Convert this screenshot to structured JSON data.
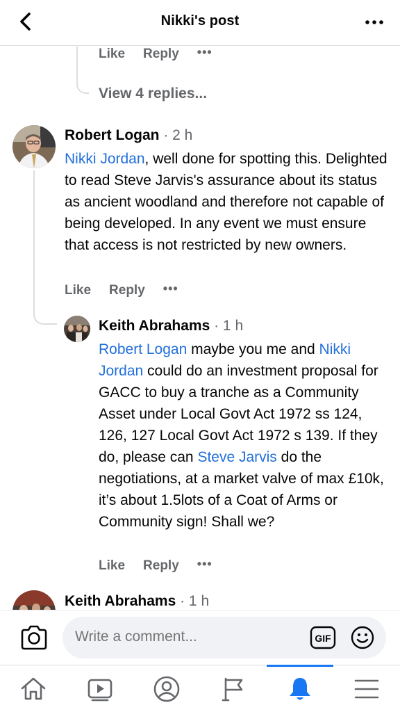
{
  "header": {
    "title": "Nikki's post"
  },
  "thread": {
    "prev_actions": {
      "like": "Like",
      "reply": "Reply",
      "more": "•••"
    },
    "view_replies": "View 4 replies..."
  },
  "comment1": {
    "author": "Robert Logan",
    "time": " · 2 h",
    "tag": "Nikki Jordan",
    "text": ", well done for spotting this. Delighted to read Steve Jarvis's assurance about its status as ancient woodland and therefore not capable of being developed. In any event we must ensure that access is not restricted by new owners.",
    "like": "Like",
    "reply": "Reply",
    "more": "•••"
  },
  "reply1": {
    "author": "Keith Abrahams",
    "time": " · 1 h",
    "tag1": "Robert Logan",
    "text1": " maybe you me and ",
    "tag2": "Nikki Jordan",
    "text2": " could do an investment proposal for GACC to buy a tranche as a Community Asset under   Local Govt Act 1972 ss 124, 126, 127 Local Govt Act 1972 s 139. If they do, please can ",
    "tag3": "Steve Jarvis",
    "text3": " do the negotiations, at a market valve of max £10k, it’s about 1.5lots of a Coat of Arms or Community sign! Shall we?",
    "like": "Like",
    "reply": "Reply",
    "more": "•••"
  },
  "reply2": {
    "author": "Keith Abrahams",
    "time": " · 1 h"
  },
  "composer": {
    "placeholder": "Write a comment..."
  },
  "tabbar": {
    "active": "notifications",
    "accent": "#1877f2"
  },
  "colors": {
    "link": "#216fdb",
    "muted": "#65676b"
  }
}
